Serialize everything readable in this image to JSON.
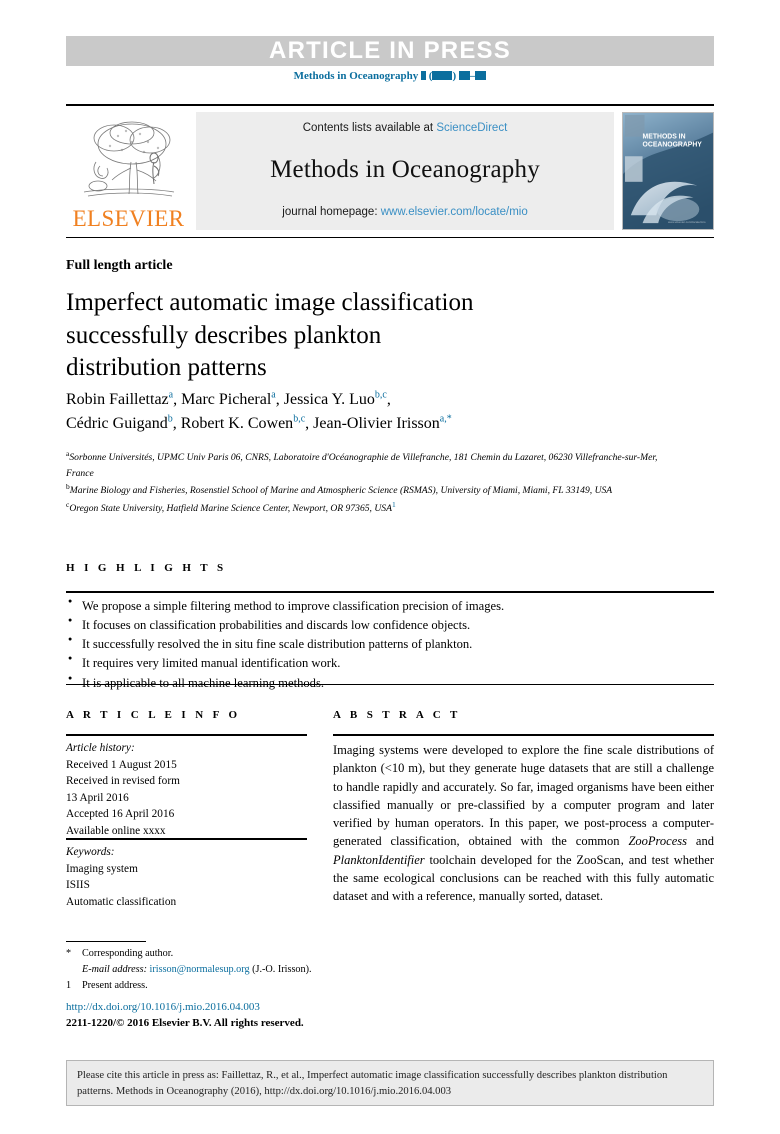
{
  "banner": {
    "text": "ARTICLE IN PRESS",
    "bg_color": "#c9c9c9",
    "text_color": "#ffffff"
  },
  "journal_ref": {
    "name": "Methods in Oceanography",
    "volume_placeholder": "▮",
    "year_placeholder": "(▮▮▮▮)",
    "pages_placeholder": "▮▮–▮▮",
    "color": "#0b6e9e"
  },
  "masthead": {
    "publisher": "ELSEVIER",
    "publisher_color": "#f08020",
    "contents_prefix": "Contents lists available at ",
    "contents_link": "ScienceDirect",
    "journal_title": "Methods in Oceanography",
    "homepage_prefix": "journal homepage: ",
    "homepage_link": "www.elsevier.com/locate/mio",
    "link_color": "#3a8fc4",
    "cover_title_line1": "METHODS IN",
    "cover_title_line2": "OCEANOGRAPHY"
  },
  "article": {
    "type": "Full length article",
    "title_line1": "Imperfect automatic image classification",
    "title_line2": "successfully describes plankton",
    "title_line3": "distribution patterns",
    "authors": [
      {
        "name": "Robin Faillettaz",
        "marks": "a",
        "sep": ", "
      },
      {
        "name": "Marc Picheral",
        "marks": "a",
        "sep": ", "
      },
      {
        "name": "Jessica Y. Luo",
        "marks": "b,c",
        "sep": ", "
      },
      {
        "name": "Cédric Guigand",
        "marks": "b",
        "sep": ", "
      },
      {
        "name": "Robert K. Cowen",
        "marks": "b,c",
        "sep": ", "
      },
      {
        "name": "Jean-Olivier Irisson",
        "marks": "a,*",
        "sep": ""
      }
    ],
    "affiliations": [
      {
        "mark": "a",
        "text": "Sorbonne Universités, UPMC Univ Paris 06, CNRS, Laboratoire d'Océanographie de Villefranche, 181 Chemin du Lazaret, 06230 Villefranche-sur-Mer, France",
        "trailing_mark": ""
      },
      {
        "mark": "b",
        "text": "Marine Biology and Fisheries, Rosenstiel School of Marine and Atmospheric Science (RSMAS), University of Miami, Miami, FL 33149, USA",
        "trailing_mark": ""
      },
      {
        "mark": "c",
        "text": "Oregon State University, Hatfield Marine Science Center, Newport, OR 97365, USA",
        "trailing_mark": "1"
      }
    ]
  },
  "highlights": {
    "heading": "H I G H L I G H T S",
    "items": [
      "We propose a simple filtering method to improve classification precision of images.",
      "It focuses on classification probabilities and discards low confidence objects.",
      "It successfully resolved the in situ fine scale distribution patterns of plankton.",
      "It requires very limited manual identification work.",
      "It is applicable to all machine learning methods."
    ]
  },
  "article_info": {
    "heading": "A R T I C L E I N F O",
    "history_label": "Article history:",
    "history": [
      "Received 1 August 2015",
      "Received in revised form",
      "13 April 2016",
      "Accepted 16 April 2016",
      "Available online xxxx"
    ],
    "keywords_label": "Keywords:",
    "keywords": [
      "Imaging system",
      "ISIIS",
      "Automatic classification"
    ]
  },
  "abstract": {
    "heading": "A B S T R A C T",
    "text_part1": "Imaging systems were developed to explore the fine scale distributions of plankton (<10 m), but they generate huge datasets that are still a challenge to handle rapidly and accurately. So far, imaged organisms have been either classified manually or pre-classified by a computer program and later verified by human operators. In this paper, we post-process a computer-generated classification, obtained with the common ",
    "italic1": "ZooProcess",
    "text_part2": " and ",
    "italic2": "PlanktonIdentifier",
    "text_part3": " toolchain developed for the ZooScan, and test whether the same ecological conclusions can be reached with this fully automatic dataset and with a reference, manually sorted, dataset."
  },
  "footnotes": {
    "corresponding_mark": "*",
    "corresponding_text": "Corresponding author.",
    "email_label": "E-mail address:",
    "email": "irisson@normalesup.org",
    "email_suffix": "(J.-O. Irisson).",
    "present_mark": "1",
    "present_text": "Present address.",
    "doi_url": "http://dx.doi.org/10.1016/j.mio.2016.04.003",
    "copyright": "2211-1220/© 2016 Elsevier B.V. All rights reserved."
  },
  "cite_box": {
    "text": "Please cite this article in press as: Faillettaz, R., et al., Imperfect automatic image classification successfully describes plankton distribution patterns. Methods in Oceanography (2016), http://dx.doi.org/10.1016/j.mio.2016.04.003",
    "bg_color": "#ebebeb"
  }
}
